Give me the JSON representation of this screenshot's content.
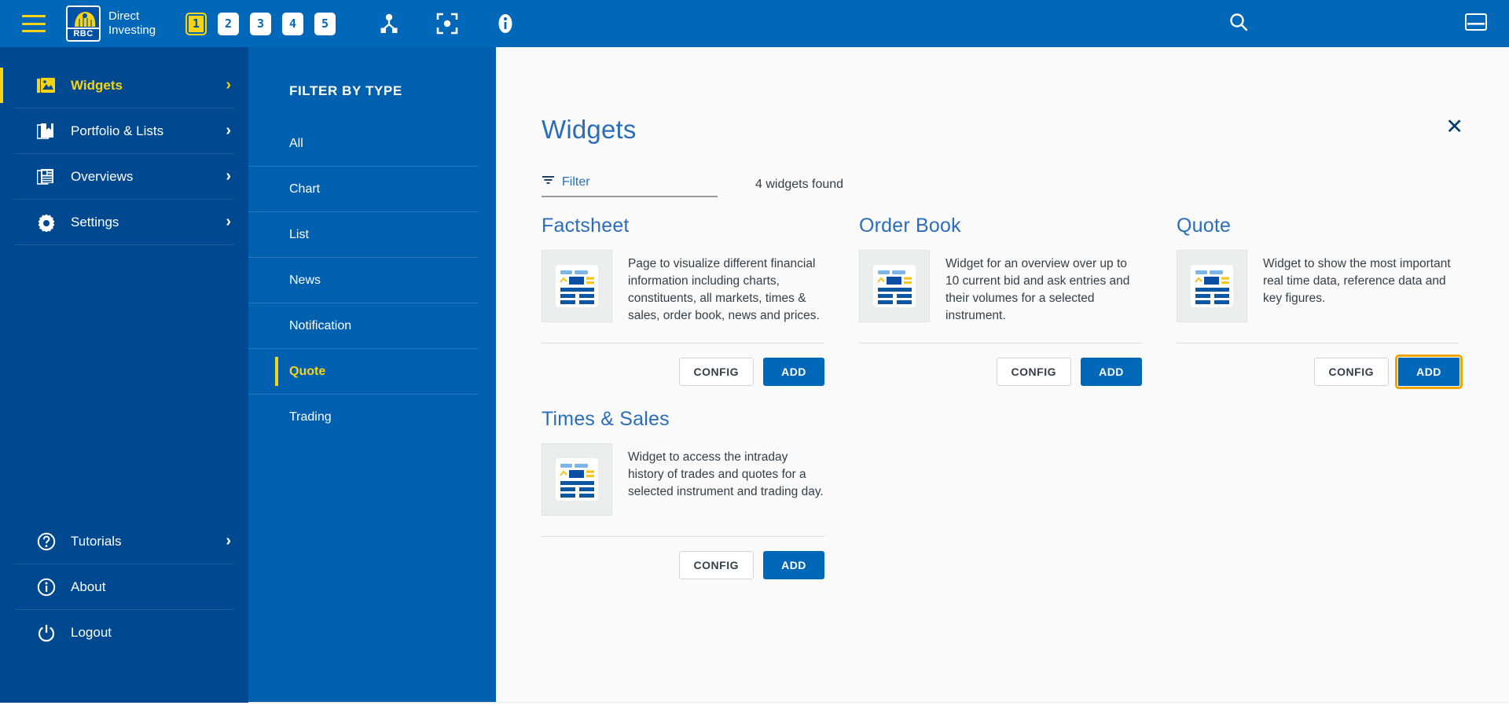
{
  "header": {
    "menu_icon": "hamburger-icon",
    "brand": {
      "logo_text": "RBC",
      "line1": "Direct",
      "line2": "Investing"
    },
    "page_tabs": [
      {
        "label": "1",
        "active": true
      },
      {
        "label": "2",
        "active": false
      },
      {
        "label": "3",
        "active": false
      },
      {
        "label": "4",
        "active": false
      },
      {
        "label": "5",
        "active": false
      }
    ],
    "tools": [
      {
        "name": "link-node-icon"
      },
      {
        "name": "focus-target-icon"
      },
      {
        "name": "info-icon"
      }
    ],
    "search_icon": "search-icon",
    "layout_icon": "layout-panel-icon"
  },
  "sidebar": {
    "items": [
      {
        "label": "Widgets",
        "icon": "image-widgets-icon",
        "active": true,
        "chevron": "›"
      },
      {
        "label": "Portfolio & Lists",
        "icon": "portfolio-book-icon",
        "active": false,
        "chevron": "›"
      },
      {
        "label": "Overviews",
        "icon": "overviews-pages-icon",
        "active": false,
        "chevron": "›"
      },
      {
        "label": "Settings",
        "icon": "gear-icon",
        "active": false,
        "chevron": "›"
      }
    ],
    "footer_items": [
      {
        "label": "Tutorials",
        "icon": "question-circle-icon",
        "chevron": "›"
      },
      {
        "label": "About",
        "icon": "info-circle-icon",
        "chevron": ""
      },
      {
        "label": "Logout",
        "icon": "power-icon",
        "chevron": ""
      }
    ]
  },
  "filter_panel": {
    "title": "FILTER BY TYPE",
    "items": [
      {
        "label": "All",
        "active": false
      },
      {
        "label": "Chart",
        "active": false
      },
      {
        "label": "List",
        "active": false
      },
      {
        "label": "News",
        "active": false
      },
      {
        "label": "Notification",
        "active": false
      },
      {
        "label": "Quote",
        "active": true
      },
      {
        "label": "Trading",
        "active": false
      }
    ]
  },
  "main": {
    "title": "Widgets",
    "close_label": "✕",
    "filter_placeholder": "Filter",
    "results_text": "4 widgets found",
    "buttons": {
      "config": "CONFIG",
      "add": "ADD"
    },
    "cards": [
      {
        "title": "Factsheet",
        "description": "Page to visualize different financial information including charts, constituents, all markets, times & sales, order book, news and prices.",
        "thumbnail": "widget-preview-icon",
        "add_focused": false
      },
      {
        "title": "Order Book",
        "description": "Widget for an overview over up to 10 current bid and ask entries and their volumes for a selected instrument.",
        "thumbnail": "widget-preview-icon",
        "add_focused": false
      },
      {
        "title": "Quote",
        "description": "Widget to show the most important real time data, reference data and key figures.",
        "thumbnail": "widget-preview-icon",
        "add_focused": true
      },
      {
        "title": "Times & Sales",
        "description": "Widget to access the intraday history of trades and quotes for a selected instrument and trading day.",
        "thumbnail": "widget-preview-icon",
        "add_focused": false
      }
    ]
  },
  "colors": {
    "brand_blue": "#0067b9",
    "sidebar_blue": "#004990",
    "filter_blue": "#0060b0",
    "accent_yellow": "#f7d417",
    "focus_gold": "#f0a500",
    "title_blue": "#2a6ebb",
    "text_dark": "#333f48"
  }
}
